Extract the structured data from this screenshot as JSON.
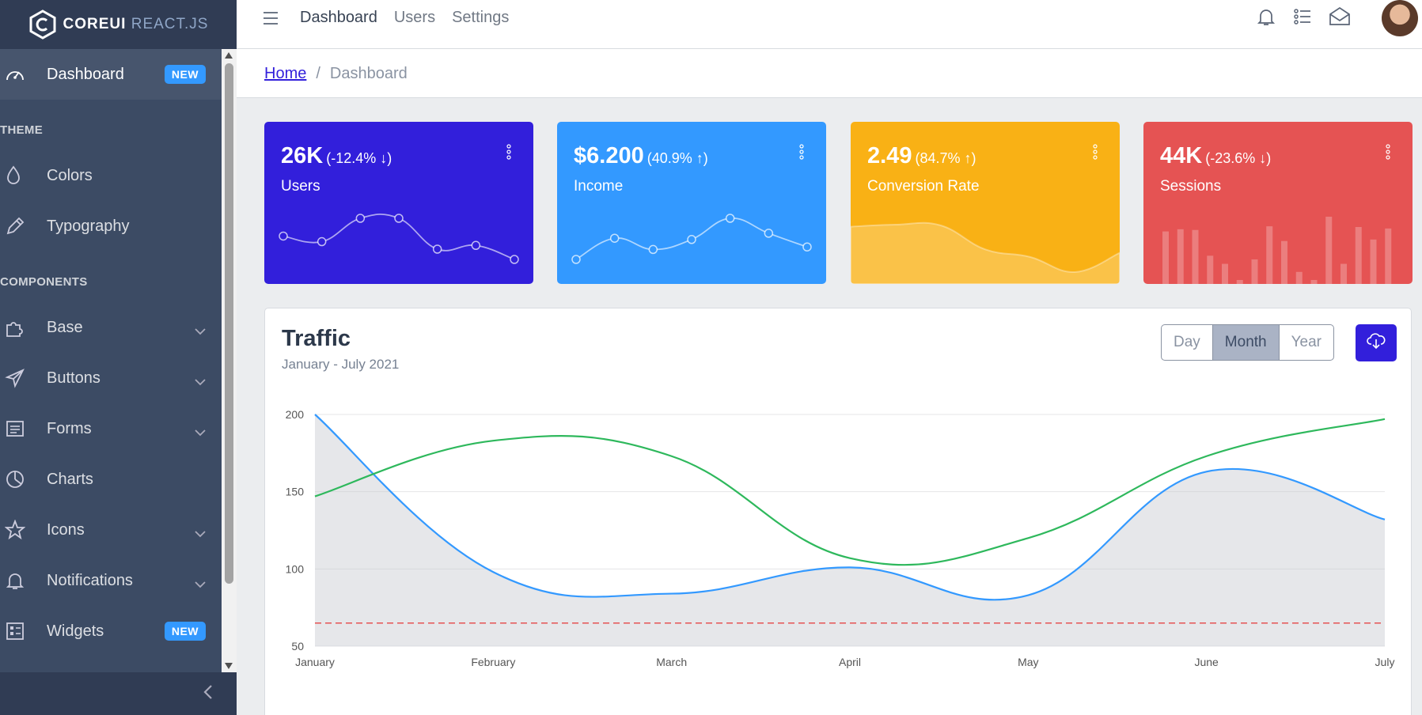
{
  "brand": {
    "name_bold": "COREUI",
    "name_light": "REACT.JS"
  },
  "header": {
    "nav": [
      "Dashboard",
      "Users",
      "Settings"
    ],
    "breadcrumb": {
      "home": "Home",
      "current": "Dashboard"
    }
  },
  "sidebar": {
    "items": [
      {
        "label": "Dashboard",
        "icon": "speedometer-icon",
        "badge": "NEW",
        "active": true
      },
      {
        "title": "THEME"
      },
      {
        "label": "Colors",
        "icon": "drop-icon"
      },
      {
        "label": "Typography",
        "icon": "pencil-icon"
      },
      {
        "title": "COMPONENTS"
      },
      {
        "label": "Base",
        "icon": "puzzle-icon",
        "dropdown": true
      },
      {
        "label": "Buttons",
        "icon": "cursor-icon",
        "dropdown": true
      },
      {
        "label": "Forms",
        "icon": "notes-icon",
        "dropdown": true
      },
      {
        "label": "Charts",
        "icon": "chart-pie-icon"
      },
      {
        "label": "Icons",
        "icon": "star-icon",
        "dropdown": true
      },
      {
        "label": "Notifications",
        "icon": "bell-icon",
        "dropdown": true
      },
      {
        "label": "Widgets",
        "icon": "calculator-icon",
        "badge": "NEW"
      }
    ]
  },
  "widgets": [
    {
      "value": "26K",
      "change": "(-12.4% ↓)",
      "label": "Users",
      "color": "#321fdb",
      "chart": [
        65,
        59,
        84,
        84,
        51,
        55,
        40
      ]
    },
    {
      "value": "$6.200",
      "change": "(40.9% ↑)",
      "label": "Income",
      "color": "#3399ff",
      "chart": [
        1,
        18,
        9,
        17,
        34,
        22,
        11
      ]
    },
    {
      "value": "2.49",
      "change": "(84.7% ↑)",
      "label": "Conversion Rate",
      "color": "#f9b115",
      "chart": [
        78,
        81,
        80,
        45,
        34,
        12,
        40
      ]
    },
    {
      "value": "44K",
      "change": "(-23.6% ↓)",
      "label": "Sessions",
      "color": "#e55353",
      "chart": [
        78,
        81,
        80,
        45,
        34,
        12,
        40,
        85,
        65,
        23,
        12,
        98,
        34,
        84,
        67,
        82
      ]
    }
  ],
  "traffic": {
    "title": "Traffic",
    "subtitle": "January - July 2021",
    "buttons": [
      "Day",
      "Month",
      "Year"
    ],
    "selected": "Month"
  },
  "chart_data": {
    "type": "line",
    "categories": [
      "January",
      "February",
      "March",
      "April",
      "May",
      "June",
      "July"
    ],
    "ylim": [
      50,
      200
    ],
    "yticks": [
      50,
      100,
      150,
      200
    ],
    "grid": true,
    "series": [
      {
        "values": [
          200,
          98,
          84,
          101,
          83,
          163,
          132
        ],
        "color": "#3399ff",
        "fill": true
      },
      {
        "values": [
          147,
          183,
          173,
          107,
          120,
          173,
          197
        ],
        "color": "#2eb85c"
      },
      {
        "values": [
          65,
          65,
          65,
          65,
          65,
          65,
          65
        ],
        "color": "#e55353",
        "dashed": true
      }
    ]
  }
}
